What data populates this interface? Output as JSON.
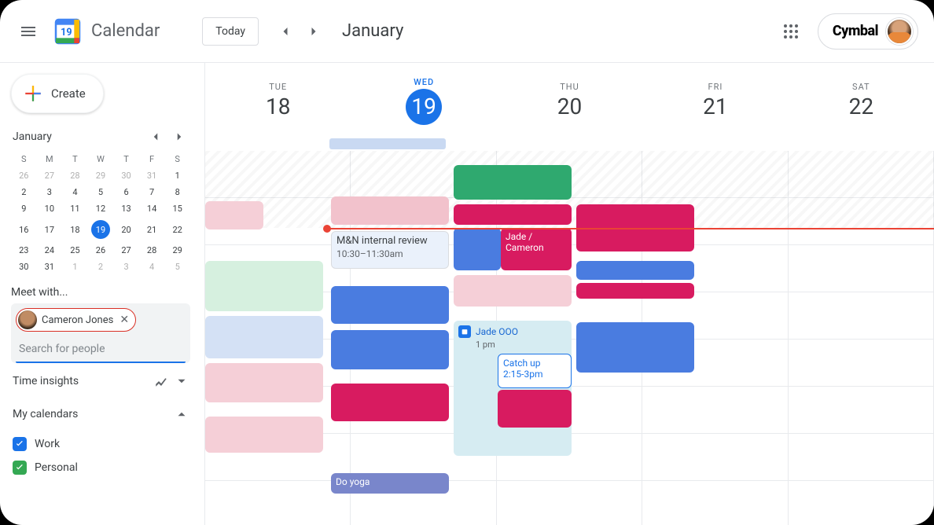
{
  "header": {
    "app_name": "Calendar",
    "today_btn": "Today",
    "month_title": "January",
    "brand": "Cymbal"
  },
  "sidebar": {
    "create_label": "Create",
    "minical_month": "January",
    "dow": [
      "S",
      "M",
      "T",
      "W",
      "T",
      "F",
      "S"
    ],
    "rows": [
      [
        {
          "n": "26",
          "m": true
        },
        {
          "n": "27",
          "m": true
        },
        {
          "n": "28",
          "m": true
        },
        {
          "n": "29",
          "m": true
        },
        {
          "n": "30",
          "m": true
        },
        {
          "n": "31",
          "m": true
        },
        {
          "n": "1"
        }
      ],
      [
        {
          "n": "2"
        },
        {
          "n": "3"
        },
        {
          "n": "4"
        },
        {
          "n": "5"
        },
        {
          "n": "6"
        },
        {
          "n": "7"
        },
        {
          "n": "8"
        }
      ],
      [
        {
          "n": "9"
        },
        {
          "n": "10"
        },
        {
          "n": "11"
        },
        {
          "n": "12"
        },
        {
          "n": "13"
        },
        {
          "n": "14"
        },
        {
          "n": "15"
        }
      ],
      [
        {
          "n": "16"
        },
        {
          "n": "17"
        },
        {
          "n": "18"
        },
        {
          "n": "19",
          "t": true
        },
        {
          "n": "20"
        },
        {
          "n": "21"
        },
        {
          "n": "22"
        }
      ],
      [
        {
          "n": "23"
        },
        {
          "n": "24"
        },
        {
          "n": "25"
        },
        {
          "n": "26"
        },
        {
          "n": "27"
        },
        {
          "n": "28"
        },
        {
          "n": "29"
        }
      ],
      [
        {
          "n": "30"
        },
        {
          "n": "31"
        },
        {
          "n": "1",
          "m": true
        },
        {
          "n": "2",
          "m": true
        },
        {
          "n": "3",
          "m": true
        },
        {
          "n": "4",
          "m": true
        },
        {
          "n": "5",
          "m": true
        }
      ]
    ],
    "meet_with": "Meet with...",
    "chip_name": "Cameron Jones",
    "search_placeholder": "Search for people",
    "time_insights": "Time insights",
    "my_calendars": "My calendars",
    "cal1": "Work",
    "cal2": "Personal"
  },
  "week": {
    "days": [
      {
        "dow": "TUE",
        "num": "18"
      },
      {
        "dow": "WED",
        "num": "19",
        "today": true
      },
      {
        "dow": "THU",
        "num": "20"
      },
      {
        "dow": "FRI",
        "num": "21"
      },
      {
        "dow": "SAT",
        "num": "22"
      }
    ]
  },
  "events": {
    "nm_review_title": "M&N internal review",
    "nm_review_time": "10:30–11:30am",
    "jade_cam": "Jade / Cameron",
    "jade_ooo": "Jade OOO",
    "jade_ooo_time": "1 pm",
    "catch_up": "Catch up",
    "catch_up_time": "2:15-3pm",
    "do_yoga": "Do yoga"
  }
}
